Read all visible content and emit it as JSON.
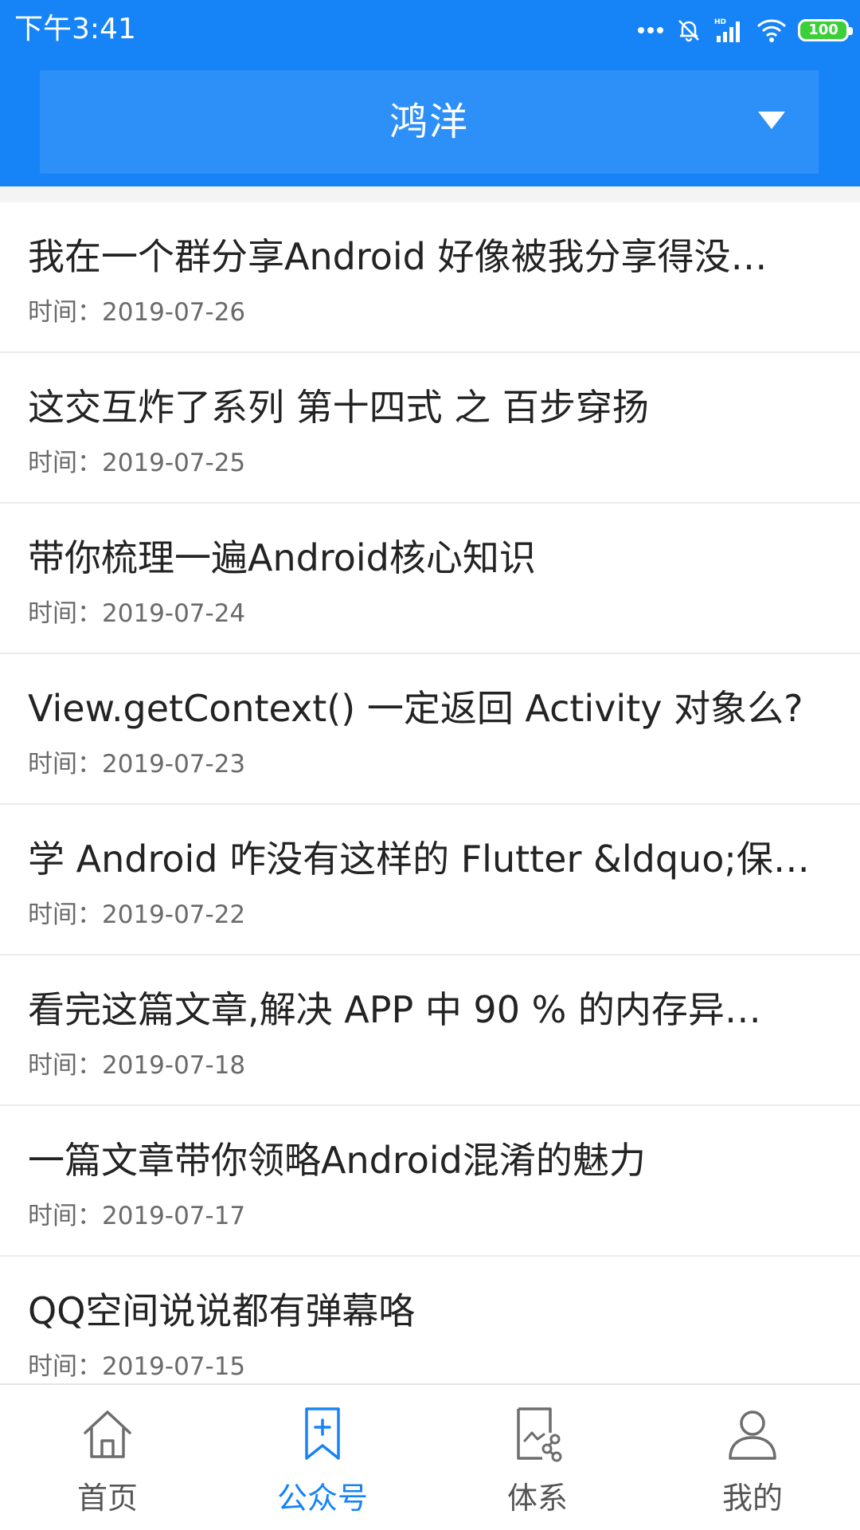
{
  "status_bar": {
    "time": "下午3:41",
    "battery": "100",
    "battery_color": "#3ccf3a",
    "icons": [
      "more-dots-icon",
      "alarm-off-icon",
      "hd-signal-icon",
      "wifi-icon",
      "battery-icon"
    ]
  },
  "header": {
    "title": "鸿洋",
    "background": "#1684f7",
    "dropdown_icon": "caret-down-icon"
  },
  "articles": [
    {
      "title": "我在一个群分享Android 好像被我分享得没…",
      "date": "时间：2019-07-26"
    },
    {
      "title": "这交互炸了系列 第十四式 之 百步穿扬",
      "date": "时间：2019-07-25"
    },
    {
      "title": "带你梳理一遍Android核心知识",
      "date": "时间：2019-07-24"
    },
    {
      "title": "View.getContext() 一定返回 Activity 对象么?",
      "date": "时间：2019-07-23"
    },
    {
      "title": "学 Android 咋没有这样的 Flutter &ldquo;保…",
      "date": "时间：2019-07-22"
    },
    {
      "title": "看完这篇文章,解决 APP 中 90 % 的内存异…",
      "date": "时间：2019-07-18"
    },
    {
      "title": "一篇文章带你领略Android混淆的魅力",
      "date": "时间：2019-07-17"
    },
    {
      "title": "QQ空间说说都有弹幕咯",
      "date": "时间：2019-07-15"
    }
  ],
  "bottom_nav": [
    {
      "label": "首页",
      "icon": "home-icon",
      "active": false
    },
    {
      "label": "公众号",
      "icon": "bookmark-add-icon",
      "active": true
    },
    {
      "label": "体系",
      "icon": "system-tree-icon",
      "active": false
    },
    {
      "label": "我的",
      "icon": "user-icon",
      "active": false
    }
  ],
  "colors": {
    "accent": "#1684f7",
    "inactive_nav": "#555555"
  }
}
